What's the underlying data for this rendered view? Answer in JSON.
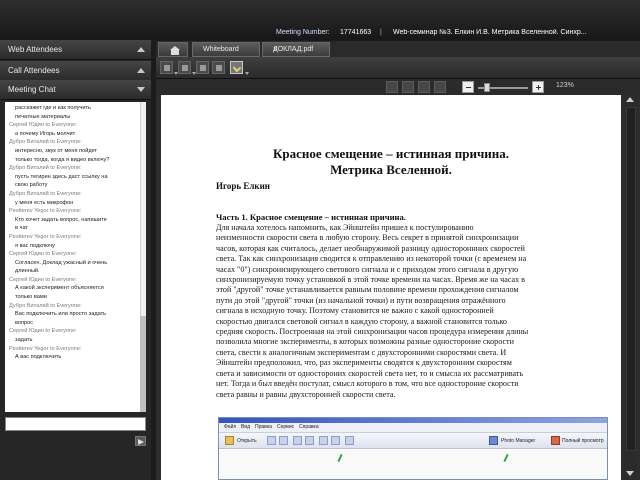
{
  "meeting": {
    "label": "Meeting Number:",
    "number": "17741663",
    "separator": "|",
    "title": "Web-семинар №3. Елкин И.В. Метрика Вселенной. Синхр..."
  },
  "left_panel": {
    "web_attendees": "Web Attendees",
    "call_attendees": "Call Attendees",
    "meeting_chat": "Meeting Chat",
    "chat_messages": [
      {
        "type": "msg",
        "text": "расскажет где и как получить"
      },
      {
        "type": "msg",
        "text": "печатные материалы"
      },
      {
        "type": "sender",
        "text": "Сергей Юдин to Everyone:"
      },
      {
        "type": "msg",
        "text": "а почему Игорь молчит"
      },
      {
        "type": "sender",
        "text": "Дубро Виталий to Everyone:"
      },
      {
        "type": "msg",
        "text": "интересно, звук от меня пойдет"
      },
      {
        "type": "msg",
        "text": "только тогда, когда я видео включу?"
      },
      {
        "type": "sender",
        "text": "Дубро Виталий to Everyone:"
      },
      {
        "type": "msg",
        "text": "пусть тегирин здесь даст ссылку на"
      },
      {
        "type": "msg",
        "text": "свою работу"
      },
      {
        "type": "sender",
        "text": "Дубро Виталий to Everyone:"
      },
      {
        "type": "msg",
        "text": "у меня есть микрофон"
      },
      {
        "type": "sender",
        "text": "Pestterev Yegor to Everyone:"
      },
      {
        "type": "msg",
        "text": "Кто хочет задать вопрос, напишите"
      },
      {
        "type": "msg",
        "text": "в чат"
      },
      {
        "type": "sender",
        "text": "Pestterev Yegor to Everyone:"
      },
      {
        "type": "msg",
        "text": "я вас подключу"
      },
      {
        "type": "sender",
        "text": "Сергей Юдин to Everyone:"
      },
      {
        "type": "msg",
        "text": "Согласен. Доклад ужасный и очень"
      },
      {
        "type": "msg",
        "text": "длинный."
      },
      {
        "type": "sender",
        "text": "Сергей Юдин to Everyone:"
      },
      {
        "type": "msg",
        "text": "А какой эксперимент объясняется"
      },
      {
        "type": "msg",
        "text": "только вами"
      },
      {
        "type": "sender",
        "text": "Дубро Виталий to Everyone:"
      },
      {
        "type": "msg",
        "text": "Вас подключить или просто задать"
      },
      {
        "type": "msg",
        "text": "вопрос"
      },
      {
        "type": "sender",
        "text": "Сергей Юдин to Everyone:"
      },
      {
        "type": "msg",
        "text": "задать"
      },
      {
        "type": "sender",
        "text": "Pestterev Yegor to Everyone:"
      },
      {
        "type": "msg",
        "text": "А вас подключить"
      }
    ]
  },
  "tabs": {
    "whiteboard": "Whiteboard",
    "doc": "ДОКЛАД.pdf",
    "close_glyph": "×"
  },
  "viewer": {
    "zoom": "123%"
  },
  "document": {
    "title_1": "Красное смещение – истинная причина.",
    "title_2": "Метрика Вселенной.",
    "author": "Игорь Елкин",
    "heading": "Часть 1.  Красное смещение – истинная причина.",
    "lines": [
      "     Для начала хотелось напомнить, как Эйнштейн пришел к постулированию",
      "неизменности скорости света в любую сторону.  Весь секрет в принятой  синхронизации",
      "часов, которая как считалось, делает необнаружимой разницу одностороннних скоростей",
      "света.  Так как синхронизация сводится к отправлению из некоторой точки (с временем на",
      "часах \"0\") синхронизирующего светового сигнала и с приходом этого сигнала в другую",
      "синхронизируемую точку установкой в этой точке времени на часах. Время же на часах в",
      "этой \"другой\" точке устанавливается равным половине времени прохождения сигналом",
      "пути до этой \"другой\"  точки (из начальной точки) и пути возвращения отражённого",
      "сигнала в исходную точку.  Поэтому становится не важно с какой одноcторонней",
      "скоростью двигался световой сигнал в каждую сторону, а важной становится только",
      "средняя скорость. Построенная на этой синхронизации часов процедура измерения длины",
      "позволила многие эксперименты, в которых возможны разные одностороние скорости",
      "света, свести к аналогичным экспериментам с двухсторонними скоростями света. И",
      "Эйнштейн предположил, что, раз эксперименты сводятся к двухсторонним скоростям",
      "света и зависимости от одностороних скоростей света нет, то и смысла их рассматривать",
      "нет. Тогда и был введён постулат, смысл которого в том, что все одностороние скорости",
      "света равны и равны двухсторонней скорости света."
    ]
  },
  "embedded_window": {
    "menus": [
      "Файл",
      "Вид",
      "Правка",
      "Сервис",
      "Справка"
    ],
    "open_label": "Открыть",
    "photo_manager_label": "Photo Manager",
    "view_label": "Полный просмотр"
  }
}
